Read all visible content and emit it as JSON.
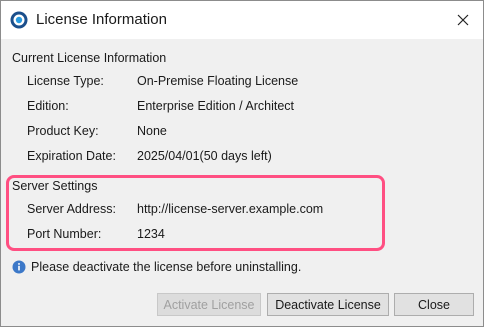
{
  "window": {
    "title": "License Information"
  },
  "current": {
    "heading": "Current License Information",
    "rows": [
      {
        "label": "License Type:",
        "value": "On-Premise Floating License"
      },
      {
        "label": "Edition:",
        "value": "Enterprise Edition / Architect"
      },
      {
        "label": "Product Key:",
        "value": "None"
      },
      {
        "label": "Expiration Date:",
        "value": "2025/04/01(50 days left)"
      }
    ]
  },
  "server": {
    "heading": "Server Settings",
    "rows": [
      {
        "label": "Server Address:",
        "value": "http://license-server.example.com"
      },
      {
        "label": "Port Number:",
        "value": "1234"
      }
    ]
  },
  "notice": {
    "icon": "info-icon",
    "text": "Please deactivate the license before uninstalling."
  },
  "buttons": {
    "activate": "Activate License",
    "deactivate": "Deactivate License",
    "close": "Close"
  },
  "colors": {
    "highlight": "#ff4f82",
    "info": "#3c78c8"
  }
}
